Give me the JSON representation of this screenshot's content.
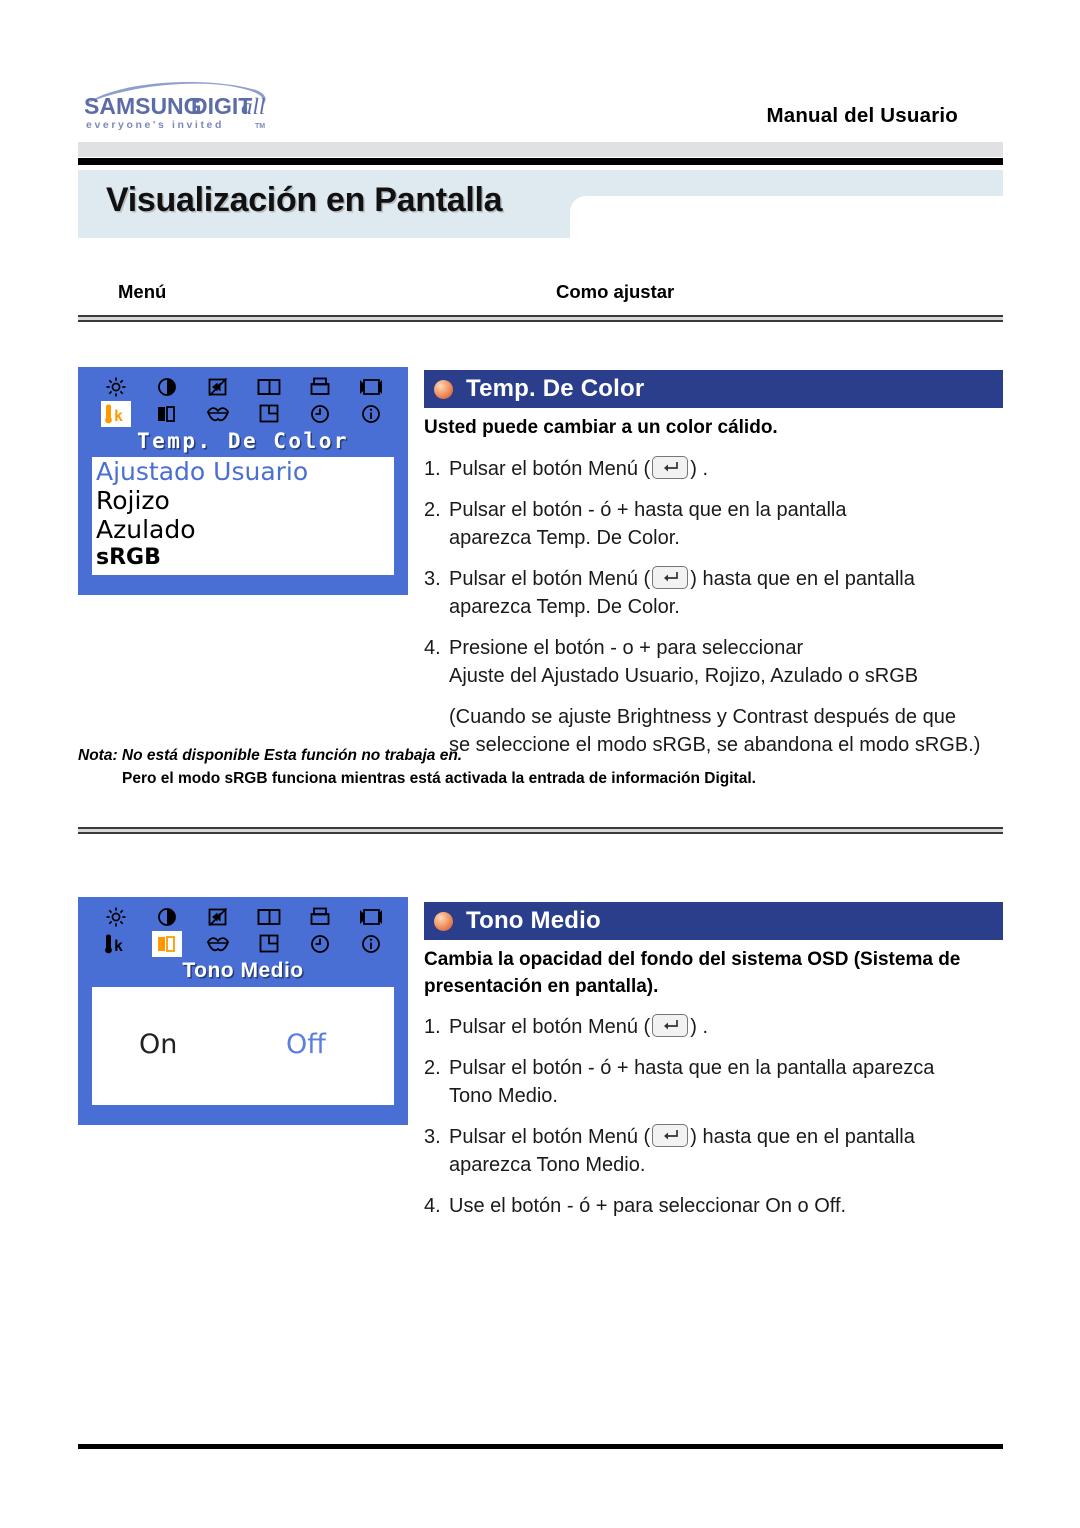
{
  "header": {
    "logo_main": "SAMSUNG DIGITall",
    "logo_tagline": "everyone's invited™",
    "manual_title": "Manual del Usuario",
    "page_title": "Visualización en Pantalla"
  },
  "columns": {
    "menu_label": "Menú",
    "howto_label": "Como ajustar"
  },
  "colors": {
    "osd_blue": "#4a6fd4",
    "section_header_blue": "#2b3e8c",
    "title_band": "#dfeaf0",
    "gray_bar": "#e0e1e3",
    "bullet_orange": "#df7140",
    "osd_selected_icon": "#ff9900"
  },
  "osd_icons": [
    {
      "name": "brightness-icon",
      "selected": false
    },
    {
      "name": "contrast-icon",
      "selected": false
    },
    {
      "name": "image-lock-icon",
      "selected": false
    },
    {
      "name": "h-position-icon",
      "selected": false
    },
    {
      "name": "image-size-icon",
      "selected": false
    },
    {
      "name": "v-position-icon",
      "selected": false
    },
    {
      "name": "color-temperature-icon",
      "selected": false
    },
    {
      "name": "osd-tone-icon",
      "selected": false
    },
    {
      "name": "language-icon",
      "selected": false
    },
    {
      "name": "osd-position-icon",
      "selected": false
    },
    {
      "name": "reset-timer-icon",
      "selected": false
    },
    {
      "name": "information-icon",
      "selected": false
    }
  ],
  "sections": [
    {
      "id": "temp-de-color",
      "osd": {
        "heading": "Temp. De Color",
        "selected_icon_index": 6,
        "type": "list",
        "items": [
          {
            "label": "Ajustado Usuario",
            "active": true,
            "small": false
          },
          {
            "label": "Rojizo",
            "active": false,
            "small": false
          },
          {
            "label": "Azulado",
            "active": false,
            "small": false
          },
          {
            "label": "sRGB",
            "active": false,
            "small": true
          }
        ]
      },
      "title": "Temp. De Color",
      "description": "Usted puede cambiar a un color cálido.",
      "steps": [
        {
          "num": "1.",
          "pre": "Pulsar el botón Menú (",
          "key": true,
          "post": ") ."
        },
        {
          "num": "2.",
          "pre": "Pulsar el botón - ó + hasta que en la pantalla",
          "key": false,
          "post": "",
          "cont": "aparezca Temp. De Color."
        },
        {
          "num": "3.",
          "pre": "Pulsar el botón Menú (",
          "key": true,
          "post": ") hasta que en el pantalla",
          "cont": "aparezca Temp. De Color."
        },
        {
          "num": "4.",
          "pre": "Presione el botón - o + para seleccionar",
          "key": false,
          "post": "",
          "cont": "Ajuste del Ajustado Usuario, Rojizo, Azulado o sRGB"
        },
        {
          "num": "",
          "pre": "(Cuando se ajuste Brightness y Contrast después de que",
          "key": false,
          "post": "",
          "cont": "se seleccione el modo sRGB, se abandona el modo sRGB.)"
        }
      ]
    },
    {
      "id": "tono-medio",
      "osd": {
        "heading": "Tono Medio",
        "selected_icon_index": 7,
        "type": "onoff",
        "on_label": "On",
        "off_label": "Off"
      },
      "title": "Tono Medio",
      "description": "Cambia la opacidad del fondo del sistema OSD (Sistema de presentación en pantalla).",
      "steps": [
        {
          "num": "1.",
          "pre": "Pulsar el botón Menú (",
          "key": true,
          "post": ") ."
        },
        {
          "num": "2.",
          "pre": "Pulsar el botón - ó + hasta que en la pantalla aparezca",
          "key": false,
          "post": "",
          "cont": "Tono Medio."
        },
        {
          "num": "3.",
          "pre": "Pulsar el botón Menú (",
          "key": true,
          "post": ") hasta que en el pantalla",
          "cont": "aparezca Tono Medio."
        },
        {
          "num": "4.",
          "pre": "Use el botón - ó + para seleccionar On o Off.",
          "key": false,
          "post": ""
        }
      ]
    }
  ],
  "nota": {
    "line1": "Nota: No está disponible  Esta función no trabaja en.",
    "line2": "Pero el modo sRGB funciona mientras está activada la entrada de información Digital."
  }
}
